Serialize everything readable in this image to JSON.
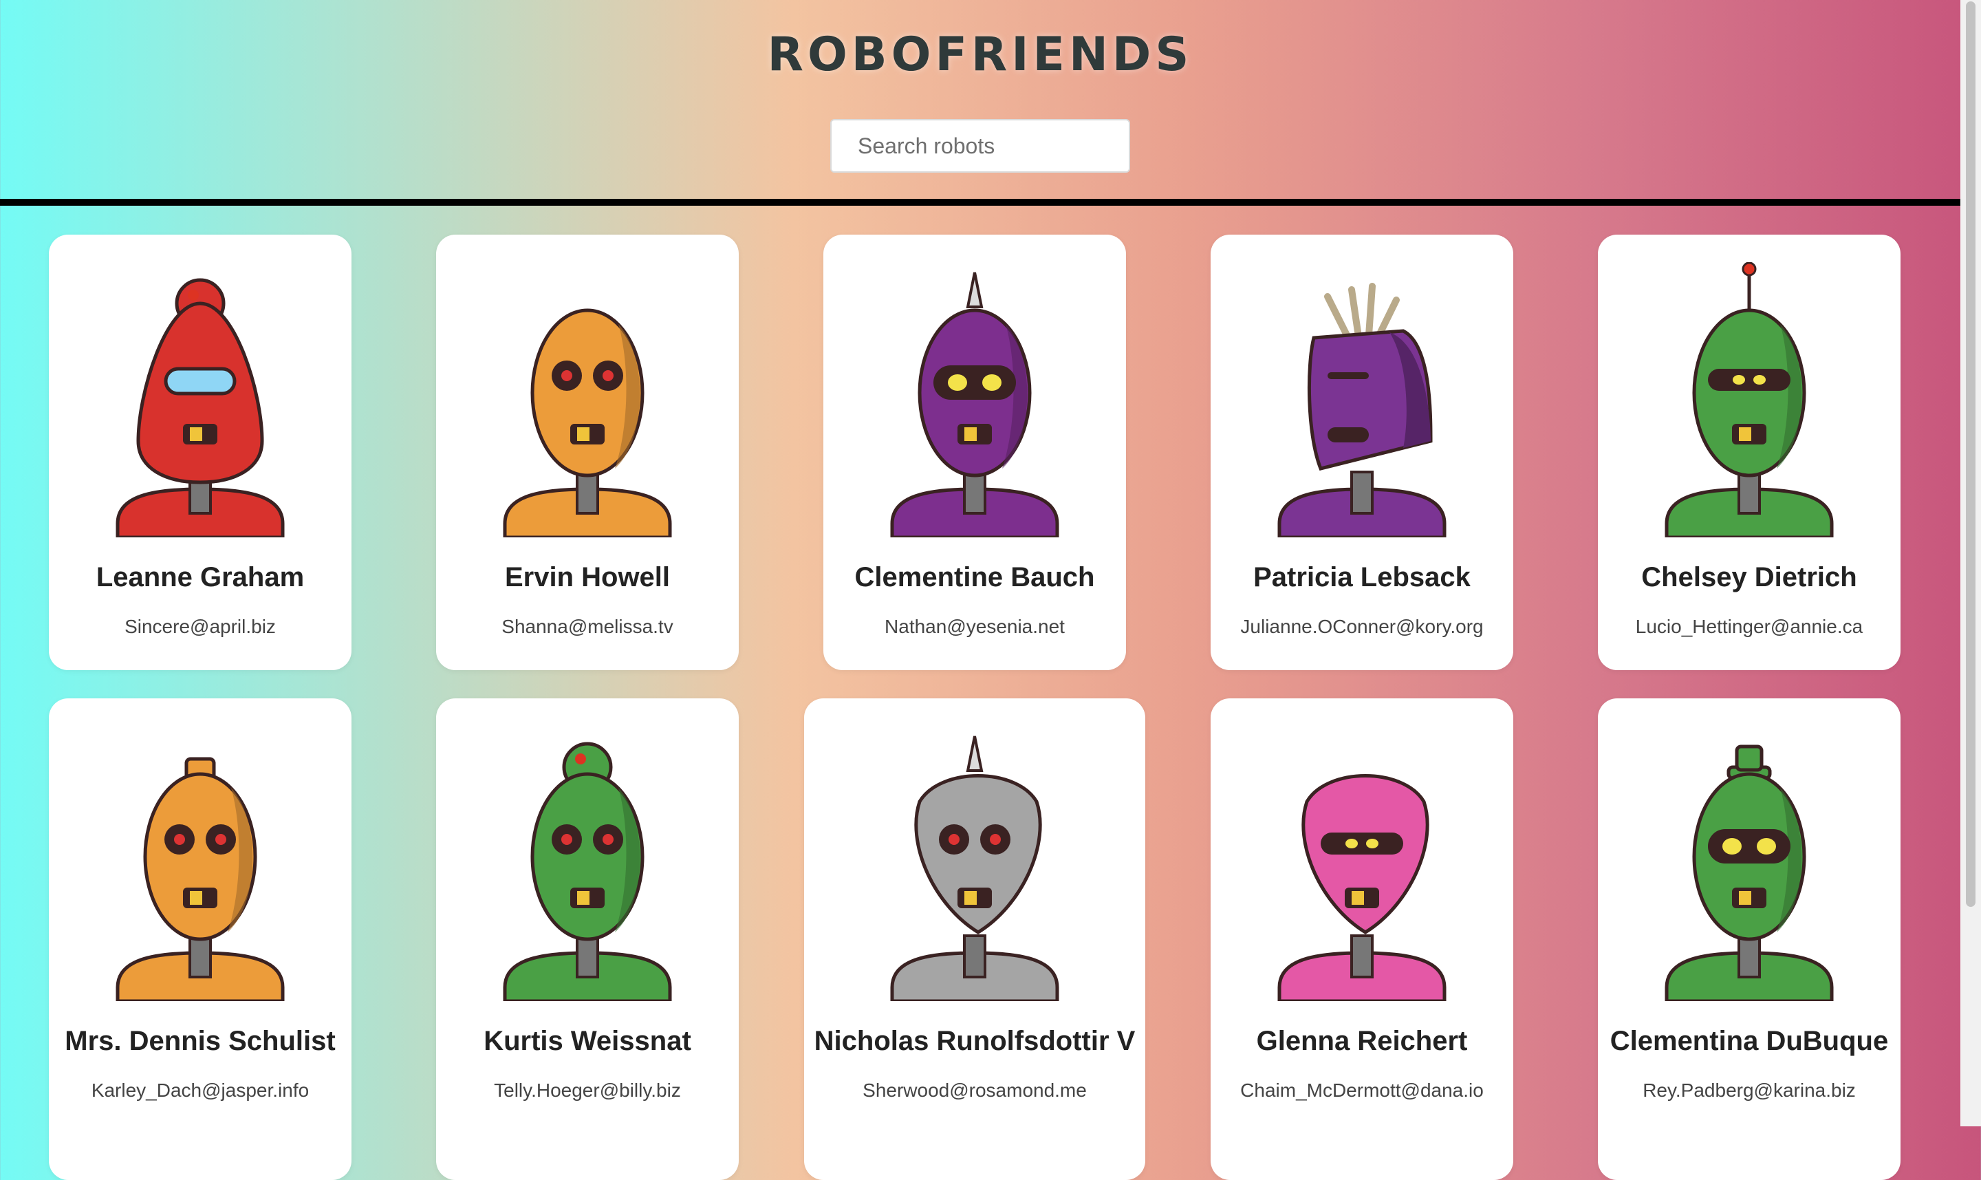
{
  "header": {
    "title": "ROBOFRIENDS",
    "search_placeholder": "Search robots",
    "search_value": ""
  },
  "colors": {
    "gradient_left": "#74fbf5",
    "gradient_right": "#c7557c",
    "card_background": "#ffffff",
    "divider": "#000000"
  },
  "robots": [
    {
      "name": "Leanne Graham",
      "email": "Sincere@april.biz",
      "color": "#d8322d",
      "shape": "dome",
      "antenna": "knob",
      "eyes": "visor",
      "icon": "robot-red-icon"
    },
    {
      "name": "Ervin Howell",
      "email": "Shanna@melissa.tv",
      "color": "#ec9c3a",
      "shape": "oval",
      "antenna": "none",
      "eyes": "round",
      "icon": "robot-orange-icon"
    },
    {
      "name": "Clementine Bauch",
      "email": "Nathan@yesenia.net",
      "color": "#7d2f8e",
      "shape": "oval",
      "antenna": "spike",
      "eyes": "goggles",
      "icon": "robot-purple-icon"
    },
    {
      "name": "Patricia Lebsack",
      "email": "Julianne.OConner@kory.org",
      "color": "#7b3493",
      "shape": "box",
      "antenna": "tuft",
      "eyes": "slit",
      "icon": "robot-purple-box-icon"
    },
    {
      "name": "Chelsey Dietrich",
      "email": "Lucio_Hettinger@annie.ca",
      "color": "#4aa045",
      "shape": "oval",
      "antenna": "rod",
      "eyes": "visor-dark",
      "icon": "robot-green-icon"
    },
    {
      "name": "Mrs. Dennis Schulist",
      "email": "Karley_Dach@jasper.info",
      "color": "#ec9c3a",
      "shape": "oval",
      "antenna": "cap",
      "eyes": "round",
      "icon": "robot-orange-small-icon"
    },
    {
      "name": "Kurtis Weissnat",
      "email": "Telly.Hoeger@billy.biz",
      "color": "#4aa045",
      "shape": "oval",
      "antenna": "knob",
      "eyes": "round",
      "icon": "robot-green-knob-icon"
    },
    {
      "name": "Nicholas Runolfsdottir V",
      "email": "Sherwood@rosamond.me",
      "color": "#a5a5a5",
      "shape": "shield",
      "antenna": "spike",
      "eyes": "round",
      "icon": "robot-gray-icon"
    },
    {
      "name": "Glenna Reichert",
      "email": "Chaim_McDermott@dana.io",
      "color": "#e458a6",
      "shape": "shield",
      "antenna": "none",
      "eyes": "visor-dark",
      "icon": "robot-pink-icon"
    },
    {
      "name": "Clementina DuBuque",
      "email": "Rey.Padberg@karina.biz",
      "color": "#4aa045",
      "shape": "oval",
      "antenna": "hat",
      "eyes": "goggles",
      "icon": "robot-green-hat-icon"
    }
  ]
}
